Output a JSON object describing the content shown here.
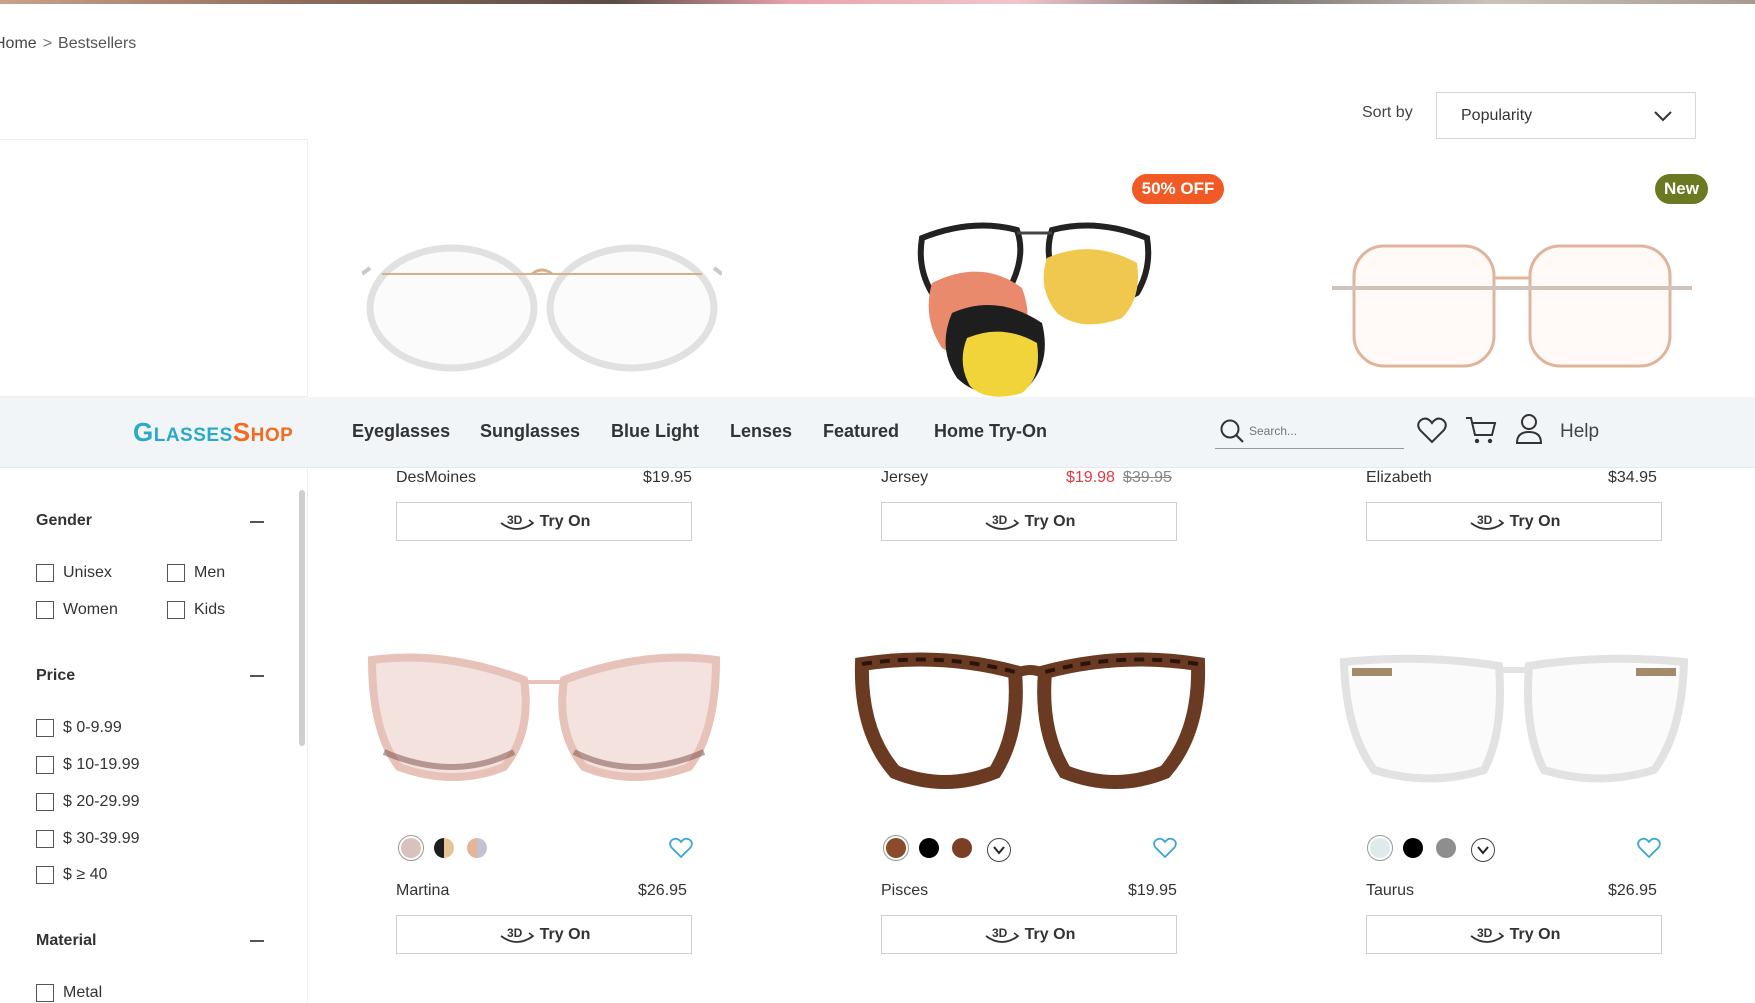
{
  "breadcrumb": {
    "home": "Home",
    "separator": ">",
    "current": "Bestsellers"
  },
  "sort": {
    "label": "Sort by",
    "value": "Popularity"
  },
  "navbar": {
    "logo": {
      "part1_initial": "G",
      "part1_rest": "LASSES",
      "part2_initial": "S",
      "part2_rest": "HOP"
    },
    "items": [
      "Eyeglasses",
      "Sunglasses",
      "Blue Light",
      "Lenses",
      "Featured",
      "Home Try-On"
    ],
    "search_placeholder": "Search...",
    "help": "Help"
  },
  "filters": {
    "gender": {
      "title": "Gender",
      "options": [
        "Unisex",
        "Men",
        "Women",
        "Kids"
      ]
    },
    "price": {
      "title": "Price",
      "options": [
        "$ 0-9.99",
        "$ 10-19.99",
        "$ 20-29.99",
        "$ 30-39.99",
        "$ ≥ 40"
      ]
    },
    "material": {
      "title": "Material",
      "options": [
        "Metal"
      ]
    }
  },
  "products": [
    {
      "name": "DesMoines",
      "price": "$19.95",
      "tryon": "Try On",
      "tryon_badge": "3D"
    },
    {
      "name": "Jersey",
      "sale_price": "$19.98",
      "original_price": "$39.95",
      "badge": "50% OFF",
      "tryon": "Try On",
      "tryon_badge": "3D"
    },
    {
      "name": "Elizabeth",
      "price": "$34.95",
      "badge": "New",
      "tryon": "Try On",
      "tryon_badge": "3D"
    },
    {
      "name": "Martina",
      "price": "$26.95",
      "tryon": "Try On",
      "tryon_badge": "3D",
      "swatches": [
        "#d9c2bd",
        "#1d1d1d",
        "#e6b497"
      ]
    },
    {
      "name": "Pisces",
      "price": "$19.95",
      "tryon": "Try On",
      "tryon_badge": "3D",
      "swatches": [
        "#8a4a2c",
        "#000000",
        "#7a3f24"
      ]
    },
    {
      "name": "Taurus",
      "price": "$26.95",
      "tryon": "Try On",
      "tryon_badge": "3D",
      "swatches": [
        "#dfeaea",
        "#000000",
        "#8e8e8e"
      ]
    }
  ],
  "colors": {
    "accent_blue": "#2aa9c9",
    "accent_orange": "#f36b21",
    "sale_red": "#e0393e",
    "new_green": "#6b7a22",
    "heart_blue": "#3aa6d8"
  }
}
